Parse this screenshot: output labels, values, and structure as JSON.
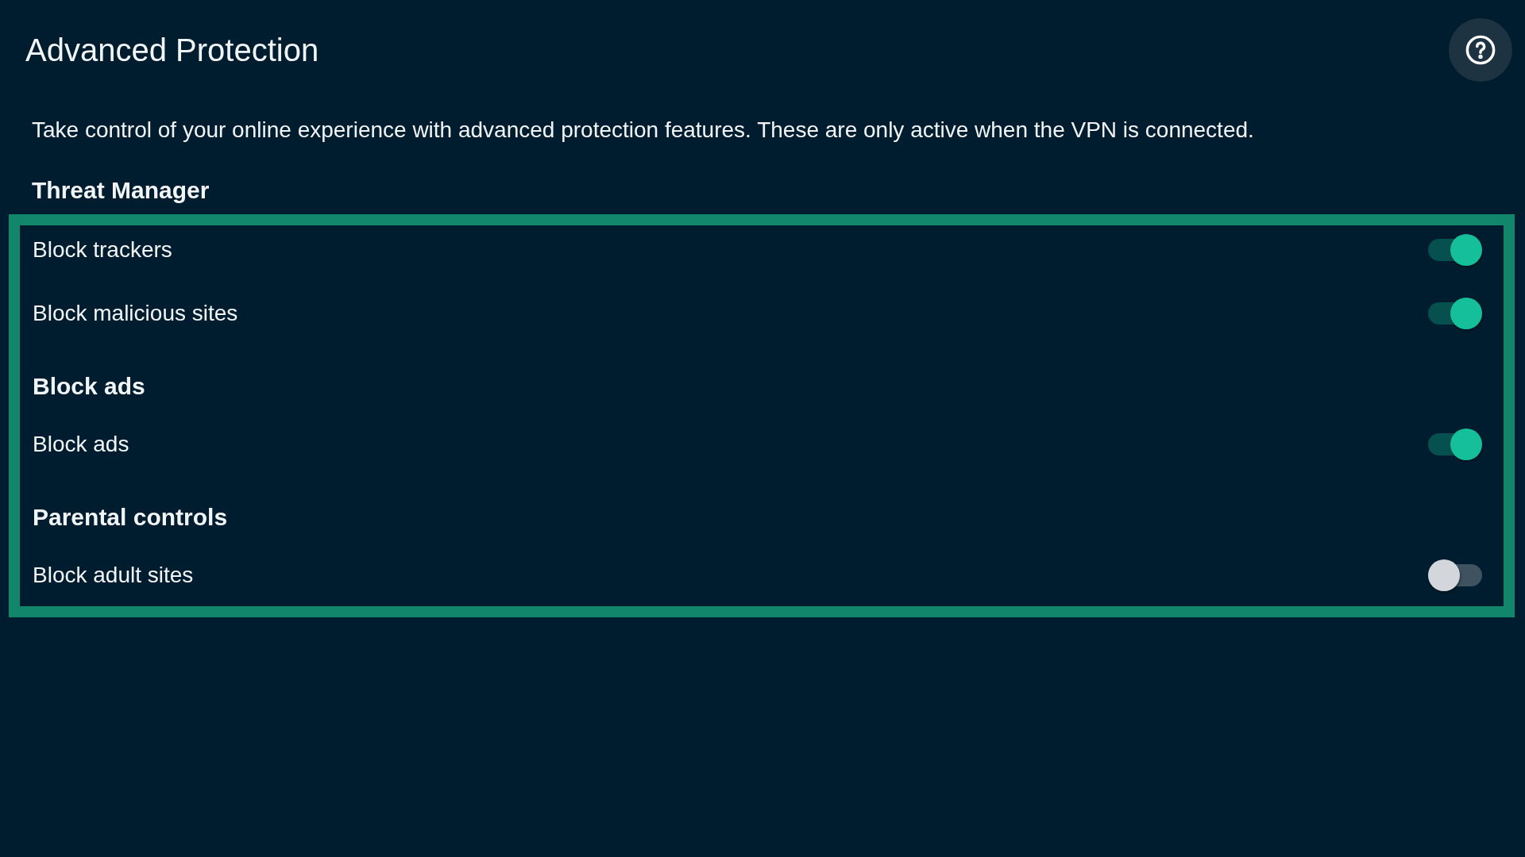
{
  "header": {
    "title": "Advanced Protection"
  },
  "description": "Take control of your online experience with advanced protection features. These are only active when the VPN is connected.",
  "section_heading": "Threat Manager",
  "settings_list": {
    "focused": true,
    "entries": [
      {
        "kind": "toggle",
        "label": "Block trackers",
        "on": true
      },
      {
        "kind": "toggle",
        "label": "Block malicious sites",
        "on": true
      },
      {
        "kind": "heading",
        "label": "Block ads"
      },
      {
        "kind": "toggle",
        "label": "Block ads",
        "on": true
      },
      {
        "kind": "heading",
        "label": "Parental controls"
      },
      {
        "kind": "toggle",
        "label": "Block adult sites",
        "on": false
      }
    ]
  }
}
